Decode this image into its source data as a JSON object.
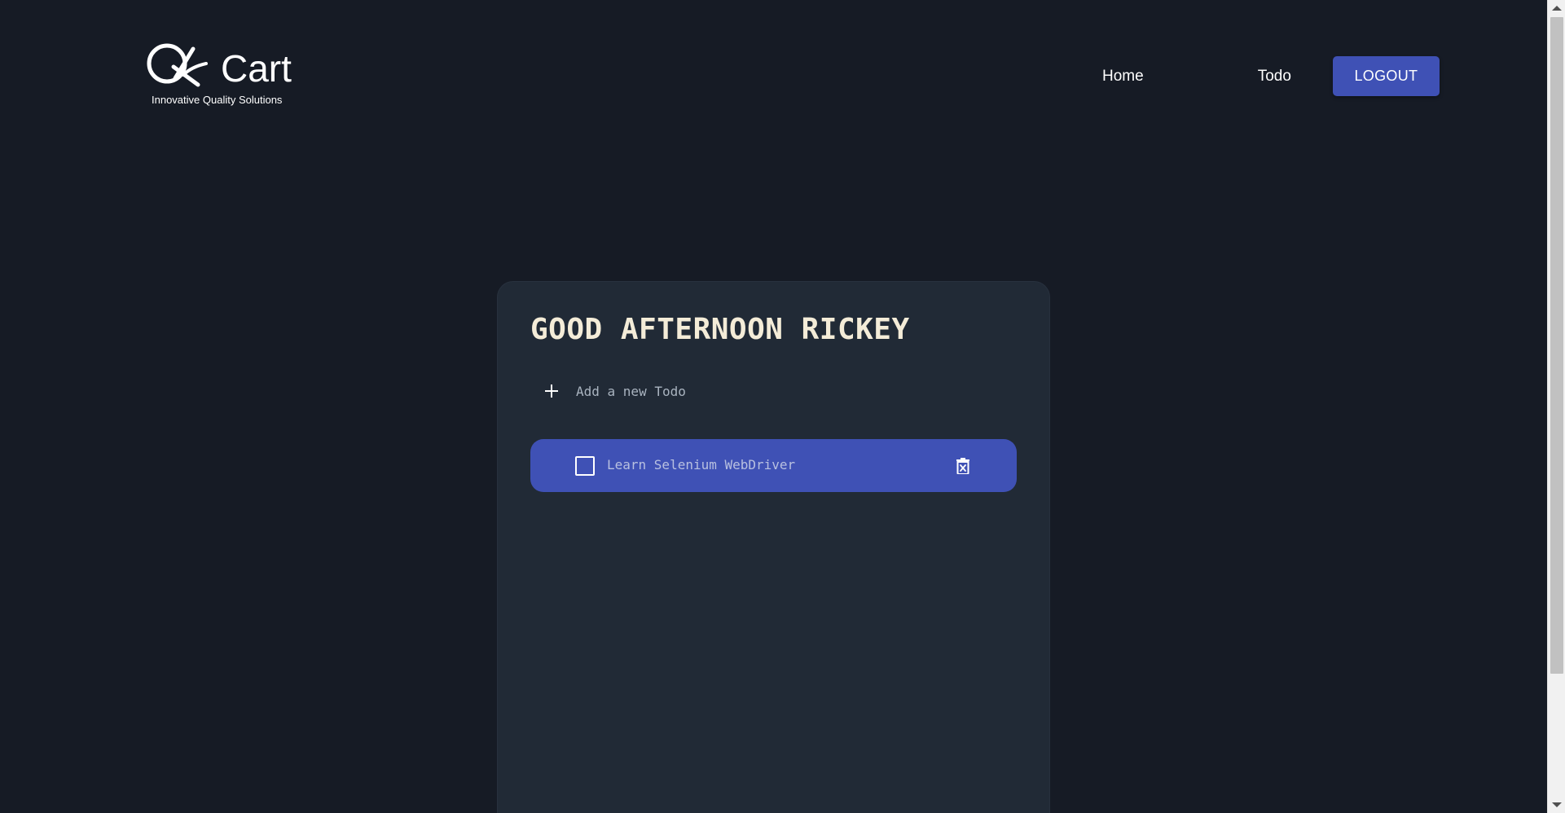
{
  "header": {
    "logo": {
      "brand_text": "QKart",
      "tagline": "Innovative Quality Solutions"
    },
    "nav": {
      "home_label": "Home",
      "todo_label": "Todo",
      "logout_label": "LOGOUT"
    }
  },
  "main": {
    "greeting": "GOOD AFTERNOON RICKEY",
    "add_todo_placeholder": "Add a new Todo",
    "todos": [
      {
        "text": "Learn Selenium WebDriver",
        "completed": false
      }
    ]
  },
  "colors": {
    "page_background": "#161b25",
    "card_background": "#212a36",
    "accent": "#3f51b5",
    "greeting_text": "#f4ecd8"
  },
  "icons": {
    "add": "plus-icon",
    "checkbox": "checkbox-unchecked-icon",
    "delete": "trash-icon"
  }
}
